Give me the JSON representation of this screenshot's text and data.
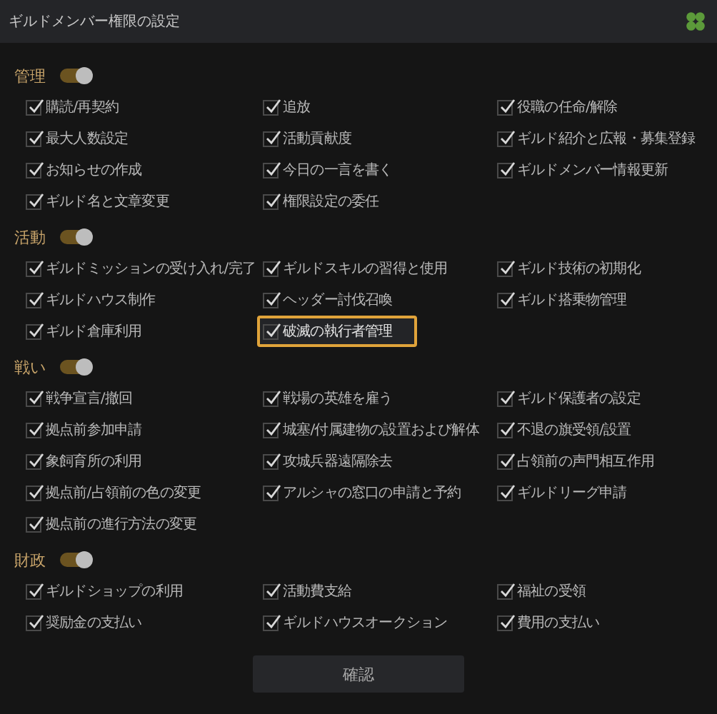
{
  "window": {
    "title": "ギルドメンバー権限の設定"
  },
  "sections": [
    {
      "title": "管理",
      "on": true,
      "items": [
        {
          "label": "購読/再契約",
          "checked": true,
          "selected": false
        },
        {
          "label": "追放",
          "checked": true,
          "selected": false
        },
        {
          "label": "役職の任命/解除",
          "checked": true,
          "selected": false
        },
        {
          "label": "最大人数設定",
          "checked": true,
          "selected": false
        },
        {
          "label": "活動貢献度",
          "checked": true,
          "selected": false
        },
        {
          "label": "ギルド紹介と広報・募集登録",
          "checked": true,
          "selected": false
        },
        {
          "label": "お知らせの作成",
          "checked": true,
          "selected": false
        },
        {
          "label": "今日の一言を書く",
          "checked": true,
          "selected": false
        },
        {
          "label": "ギルドメンバー情報更新",
          "checked": true,
          "selected": false
        },
        {
          "label": "ギルド名と文章変更",
          "checked": true,
          "selected": false
        },
        {
          "label": "権限設定の委任",
          "checked": true,
          "selected": false
        }
      ]
    },
    {
      "title": "活動",
      "on": true,
      "items": [
        {
          "label": "ギルドミッションの受け入れ/完了",
          "checked": true,
          "selected": false
        },
        {
          "label": "ギルドスキルの習得と使用",
          "checked": true,
          "selected": false
        },
        {
          "label": "ギルド技術の初期化",
          "checked": true,
          "selected": false
        },
        {
          "label": "ギルドハウス制作",
          "checked": true,
          "selected": false
        },
        {
          "label": "ヘッダー討伐召喚",
          "checked": true,
          "selected": false
        },
        {
          "label": "ギルド搭乗物管理",
          "checked": true,
          "selected": false
        },
        {
          "label": "ギルド倉庫利用",
          "checked": true,
          "selected": false
        },
        {
          "label": "破滅の執行者管理",
          "checked": true,
          "selected": true
        }
      ]
    },
    {
      "title": "戦い",
      "on": true,
      "items": [
        {
          "label": "戦争宣言/撤回",
          "checked": true,
          "selected": false
        },
        {
          "label": "戦場の英雄を雇う",
          "checked": true,
          "selected": false
        },
        {
          "label": "ギルド保護者の設定",
          "checked": true,
          "selected": false
        },
        {
          "label": "拠点前参加申請",
          "checked": true,
          "selected": false
        },
        {
          "label": "城塞/付属建物の設置および解体",
          "checked": true,
          "selected": false
        },
        {
          "label": "不退の旗受領/設置",
          "checked": true,
          "selected": false
        },
        {
          "label": "象飼育所の利用",
          "checked": true,
          "selected": false
        },
        {
          "label": "攻城兵器遠隔除去",
          "checked": true,
          "selected": false
        },
        {
          "label": "占領前の声門相互作用",
          "checked": true,
          "selected": false
        },
        {
          "label": "拠点前/占領前の色の変更",
          "checked": true,
          "selected": false
        },
        {
          "label": "アルシャの窓口の申請と予約",
          "checked": true,
          "selected": false
        },
        {
          "label": "ギルドリーグ申請",
          "checked": true,
          "selected": false
        },
        {
          "label": "拠点前の進行方法の変更",
          "checked": true,
          "selected": false
        }
      ]
    },
    {
      "title": "財政",
      "on": true,
      "items": [
        {
          "label": "ギルドショップの利用",
          "checked": true,
          "selected": false
        },
        {
          "label": "活動費支給",
          "checked": true,
          "selected": false
        },
        {
          "label": "福祉の受領",
          "checked": true,
          "selected": false
        },
        {
          "label": "奨励金の支払い",
          "checked": true,
          "selected": false
        },
        {
          "label": "ギルドハウスオークション",
          "checked": true,
          "selected": false
        },
        {
          "label": "費用の支払い",
          "checked": true,
          "selected": false
        }
      ]
    }
  ],
  "confirm_button": "確認"
}
